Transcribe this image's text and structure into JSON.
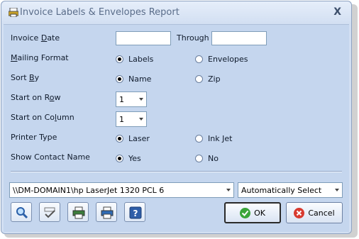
{
  "window": {
    "title": "Invoice Labels & Envelopes Report",
    "close_glyph": "X"
  },
  "form": {
    "invoice_date": {
      "label": "Invoice Date",
      "label_pre": "Invoice ",
      "label_key": "D",
      "label_post": "ate",
      "value": ""
    },
    "through": {
      "label": "Through",
      "value": ""
    },
    "mailing_format": {
      "label_pre": "",
      "label_key": "M",
      "label_post": "ailing Format",
      "options": [
        "Labels",
        "Envelopes"
      ],
      "selected": "Labels"
    },
    "sort_by": {
      "label_pre": "Sort ",
      "label_key": "B",
      "label_post": "y",
      "options": [
        "Name",
        "Zip"
      ],
      "selected": "Name"
    },
    "start_row": {
      "label_pre": "Start on R",
      "label_key": "o",
      "label_post": "w",
      "value": "1"
    },
    "start_column": {
      "label_pre": "Start on Co",
      "label_key": "l",
      "label_post": "umn",
      "value": "1"
    },
    "printer_type": {
      "label": "Printer Type",
      "options": [
        "Laser",
        "Ink Jet"
      ],
      "selected": "Laser"
    },
    "show_contact": {
      "label": "Show Contact Name",
      "options": [
        "Yes",
        "No"
      ],
      "selected": "Yes"
    }
  },
  "printer": {
    "value": "\\\\DM-DOMAIN1\\hp LaserJet 1320 PCL 6"
  },
  "tray": {
    "value": "Automatically Select"
  },
  "toolbar": {
    "icons": [
      "preview-magnifier-icon",
      "spell-check-icon",
      "print-setup-icon",
      "printer-icon",
      "help-icon"
    ],
    "help_glyph": "?"
  },
  "buttons": {
    "ok_label": "OK",
    "cancel_label": "Cancel"
  },
  "colors": {
    "ok_icon": "#3aa53a",
    "cancel_icon": "#d83a2f"
  }
}
